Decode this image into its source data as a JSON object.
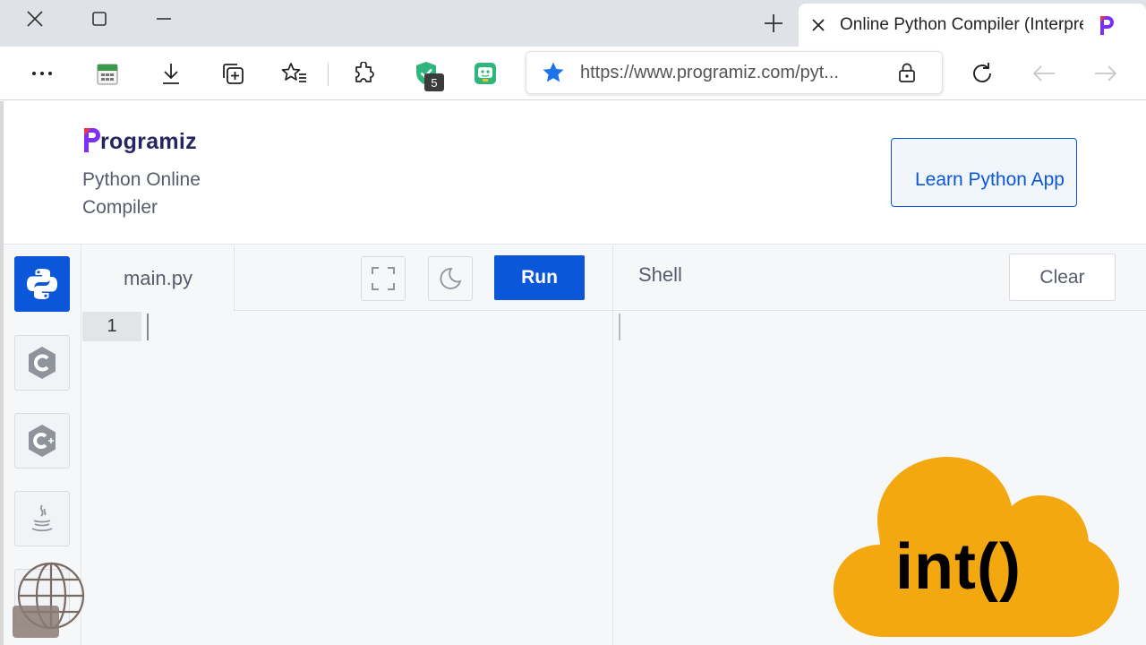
{
  "browser": {
    "tab_title": "Online Python Compiler (Interpreter)",
    "url": "https://www.programiz.com/pyt...",
    "extension_badge": "5"
  },
  "header": {
    "logo_text": "rogramiz",
    "subtitle": "Python Online Compiler",
    "learn_button": "Learn Python App"
  },
  "editor": {
    "file_tab": "main.py",
    "run_label": "Run",
    "line_number": "1"
  },
  "shell": {
    "title": "Shell",
    "clear_label": "Clear"
  },
  "overlay": {
    "cloud_text": "int()"
  },
  "colors": {
    "brand_blue": "#0b56d9",
    "cloud_orange": "#f4a810",
    "extension_green": "#2fb67c",
    "logo_purple": "#7b2ff7"
  },
  "icons": [
    "close-window-icon",
    "restore-window-icon",
    "minimize-window-icon",
    "new-tab-icon",
    "close-tab-icon",
    "more-icon",
    "downloads-icon",
    "collections-icon",
    "favorites-icon",
    "extensions-icon",
    "favorite-star-icon",
    "lock-icon",
    "refresh-icon",
    "back-arrow-icon",
    "forward-arrow-icon",
    "fullscreen-icon",
    "dark-mode-icon",
    "python-icon",
    "c-language-icon",
    "cpp-icon",
    "java-icon",
    "globe-icon"
  ]
}
